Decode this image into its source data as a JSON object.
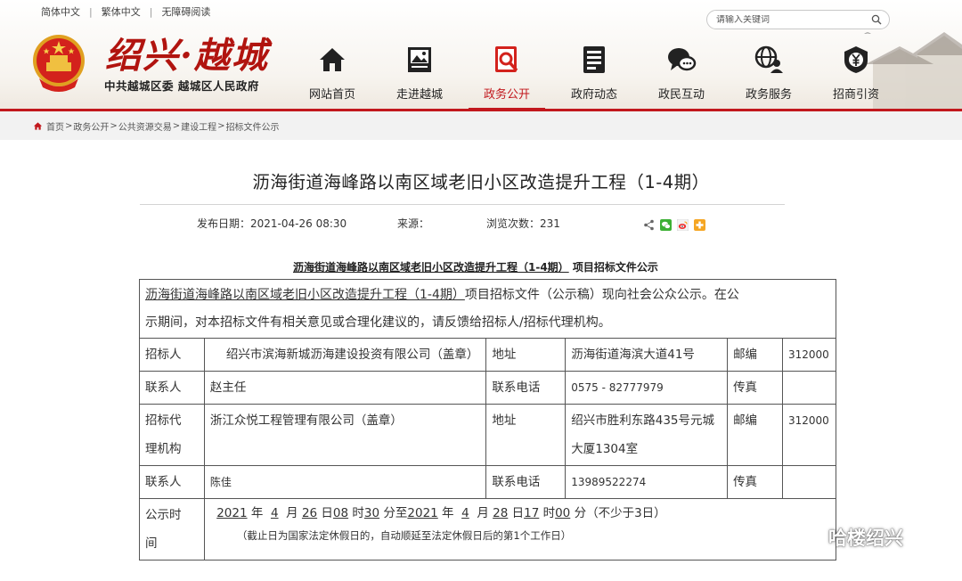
{
  "header": {
    "top_links": [
      "简体中文",
      "繁体中文",
      "无障碍阅读"
    ],
    "search_placeholder": "请输入关键词",
    "calligraphy": "绍兴·越城",
    "subtitle": "中共越城区委  越城区人民政府",
    "nav": [
      {
        "label": "网站首页",
        "icon": "home-icon"
      },
      {
        "label": "走进越城",
        "icon": "picture-icon"
      },
      {
        "label": "政务公开",
        "icon": "search-doc-icon",
        "active": true
      },
      {
        "label": "政府动态",
        "icon": "news-icon"
      },
      {
        "label": "政民互动",
        "icon": "chat-icon"
      },
      {
        "label": "政务服务",
        "icon": "globe-user-icon"
      },
      {
        "label": "招商引资",
        "icon": "yen-shield-icon"
      }
    ],
    "accent_color": "#c2181d"
  },
  "breadcrumb": [
    "首页",
    "政务公开",
    "公共资源交易",
    "建设工程",
    "招标文件公示"
  ],
  "article": {
    "title": "沥海街道海峰路以南区域老旧小区改造提升工程（1-4期）",
    "meta": {
      "publish_label": "发布日期：",
      "publish_date": "2021-04-26 08:30",
      "source_label": "来源：",
      "source": "",
      "views_label": "浏览次数：",
      "views": "231"
    },
    "share_icons": [
      "share-icon",
      "wechat-icon",
      "weibo-icon",
      "qzone-icon"
    ],
    "subheading_underlined": "沥海街道海峰路以南区域老旧小区改造提升工程（1-4期）",
    "subheading_rest": "项目招标文件公示",
    "intro_underlined": "沥海街道海峰路以南区域老旧小区改造提升工程（1-4期）",
    "intro_rest_line1": "项目招标文件（公示稿）现向社会公众公示。在公",
    "intro_line2": "示期间，对本招标文件有相关意见或合理化建议的，请反馈给招标人/招标代理机构。",
    "table": {
      "tenderer_label": "招标人",
      "tenderer": "绍兴市滨海新城沥海建设投资有限公司（盖章）",
      "address_label": "地址",
      "tenderer_address": "沥海街道海滨大道41号",
      "postcode_label": "邮编",
      "tenderer_postcode": "312000",
      "contact_label": "联系人",
      "tenderer_contact": "赵主任",
      "phone_label": "联系电话",
      "tenderer_phone": "0575 - 82777979",
      "fax_label": "传真",
      "tenderer_fax": "",
      "agency_label_1": "招标代",
      "agency_label_2": "理机构",
      "agency": "浙江众悦工程管理有限公司（盖章）",
      "agency_address": "绍兴市胜利东路435号元城大厦1304室",
      "agency_postcode": "312000",
      "agency_contact": "陈佳",
      "agency_phone": "13989522274",
      "agency_fax": "",
      "period_label_1": "公示时",
      "period_label_2": "间",
      "period": {
        "start_year": "2021",
        "year_label": "年",
        "start_month": "4",
        "month_label": "月",
        "start_day": "26",
        "day_label": "日",
        "start_hour": "08",
        "hour_label": "时",
        "start_min": "30",
        "min_label": "分至",
        "end_year": "2021",
        "end_month": "4",
        "end_day": "28",
        "end_hour": "17",
        "end_min": "00",
        "end_min_label": "分",
        "note": "（不少于3日）"
      },
      "period_footnote": "（截止日为国家法定休假日的，自动顺延至法定休假日后的第1个工作日）"
    }
  },
  "watermark": "哈楼绍兴"
}
